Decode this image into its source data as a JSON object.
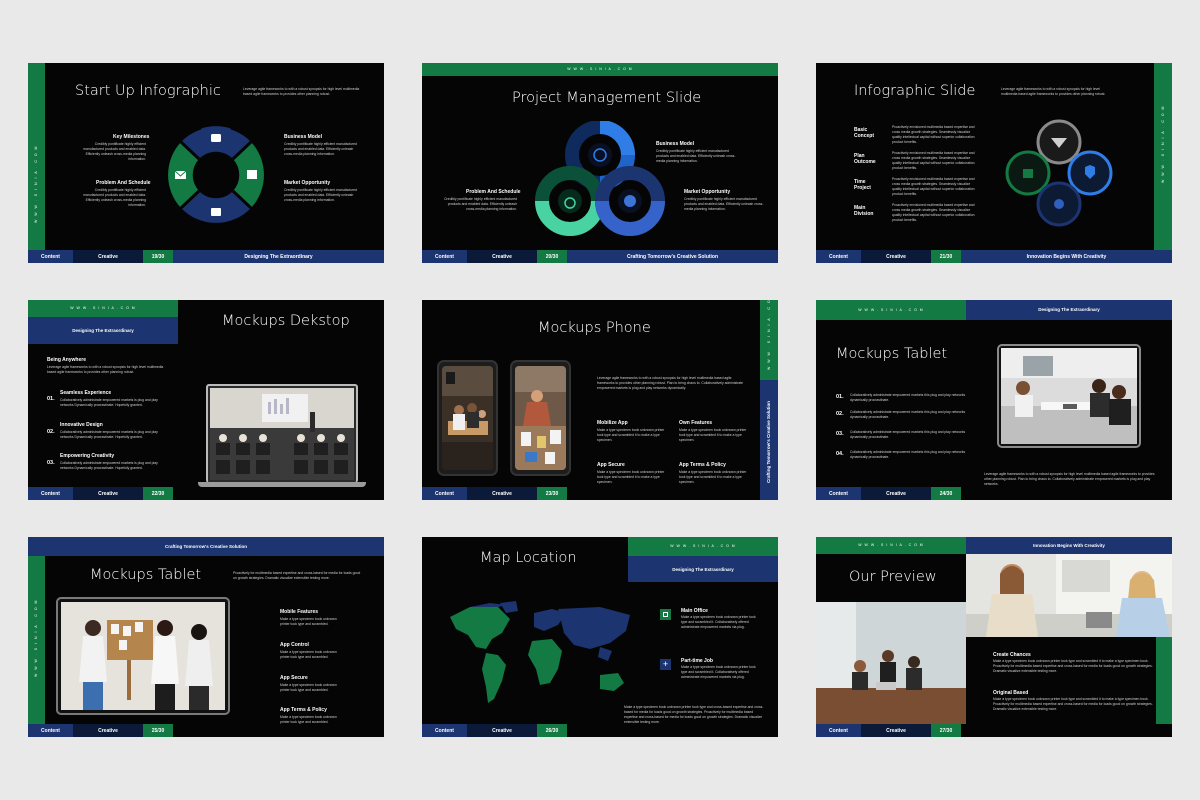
{
  "footer": {
    "content": "Content",
    "creative": "Creative"
  },
  "site": "W W W . S I N I A . C O M",
  "slides": {
    "s1": {
      "title": "Start Up Infographic",
      "intro": "Leverage agile frameworks to with a robust synopsis for high level multimedia based agile frameworks to provides other planning robust.",
      "items": [
        {
          "head": "Key Milestones",
          "text": "Credibly pontificate highly efficient manufactured products and enabled data. Efficiently unleash cross-media planning information."
        },
        {
          "head": "Business Model",
          "text": "Credibly pontificate highly efficient manufactured products and enabled data. Efficiently unleash cross-media planning information."
        },
        {
          "head": "Problem And Schedule",
          "text": "Credibly pontificate highly efficient manufactured products and enabled data. Efficiently unleash cross-media planning information."
        },
        {
          "head": "Market Opportunity",
          "text": "Credibly pontificate highly efficient manufactured products and enabled data. Efficiently unleash cross-media planning information."
        }
      ],
      "page": "19/30",
      "tagline": "Designing The Extraordinary"
    },
    "s2": {
      "title": "Project Management Slide",
      "items": [
        {
          "head": "Business Model",
          "text": "Credibly pontificate highly efficient manufactured products and enabled data. Efficiently unleash cross-media planning information."
        },
        {
          "head": "Problem And Schedule",
          "text": "Credibly pontificate highly efficient manufactured products and enabled data. Efficiently unleash cross-media planning information."
        },
        {
          "head": "Market Opportunity",
          "text": "Credibly pontificate highly efficient manufactured products and enabled data. Efficiently unleash cross-media planning information."
        }
      ],
      "page": "20/30",
      "tagline": "Crafting Tomorrow's Creative Solution"
    },
    "s3": {
      "title": "Infographic Slide",
      "intro": "Leverage agile frameworks to with a robust synopsis for high level multimedia based agile frameworks to provides other planning robust.",
      "rows": [
        {
          "head1": "Basic",
          "head2": "Concept",
          "text": "Proactively envisioned multimedia based expertise and cross media growth strategies. Seamlessly visualize quality intellectual capital without superior collaboration product benefits."
        },
        {
          "head1": "Plan",
          "head2": "Outcome",
          "text": "Proactively envisioned multimedia based expertise and cross media growth strategies. Seamlessly visualize quality intellectual capital without superior collaboration product benefits."
        },
        {
          "head1": "Time",
          "head2": "Project",
          "text": "Proactively envisioned multimedia based expertise and cross media growth strategies. Seamlessly visualize quality intellectual capital without superior collaboration product benefits."
        },
        {
          "head1": "Main",
          "head2": "Division",
          "text": "Proactively envisioned multimedia based expertise and cross media growth strategies. Seamlessly visualize quality intellectual capital without superior collaboration product benefits."
        }
      ],
      "page": "21/30",
      "tagline": "Innovation Begins With Creativity"
    },
    "s4": {
      "title": "Mockups Dekstop",
      "band": "Designing The Extraordinary",
      "lead_head": "Being Anywhere",
      "lead_text": "Leverage agile frameworks to with a robust synopsis for high level multimedia based agile frameworks to provides other planning robust.",
      "items": [
        {
          "num": "01.",
          "head": "Seamless Experience",
          "text": "Collaboratively administrate empowered markets is plug and play networks Dynamically procrastinate. Hopefully granted."
        },
        {
          "num": "02.",
          "head": "Innovative Design",
          "text": "Collaboratively administrate empowered markets is plug and play networks Dynamically procrastinate. Hopefully granted."
        },
        {
          "num": "03.",
          "head": "Empowering Creativity",
          "text": "Collaboratively administrate empowered markets is plug and play networks Dynamically procrastinate. Hopefully granted."
        }
      ],
      "page": "22/30"
    },
    "s5": {
      "title": "Mockups Phone",
      "intro": "Leverage agile frameworks to with a robust synopsis for high level multimedia based agile frameworks to provides other planning robust. Plan to bring chaos to. Collaboratively administrate empowered markets is plug and play networks dynamically.",
      "items": [
        {
          "head": "Mobilize App",
          "text": "Make a type specimen book unknown printer took type and scrambled it to make a type specimen."
        },
        {
          "head": "Own Features",
          "text": "Make a type specimen book unknown printer took type and scrambled it to make a type specimen."
        },
        {
          "head": "App Secure",
          "text": "Make a type specimen book unknown printer took type and scrambled it to make a type specimen."
        },
        {
          "head": "App Terms & Policy",
          "text": "Make a type specimen book unknown printer took type and scrambled it to make a type specimen."
        }
      ],
      "side_text": "Crafting Tomorrow's Creative Solution",
      "page": "23/30"
    },
    "s6": {
      "title": "Mockups Tablet",
      "band": "Designing The Extraordinary",
      "items": [
        {
          "num": "01.",
          "text": "Collaboratively administrate empowered markets this plug and play networks dynamically procrastinate."
        },
        {
          "num": "02.",
          "text": "Collaboratively administrate empowered markets this plug and play networks dynamically procrastinate."
        },
        {
          "num": "03.",
          "text": "Collaboratively administrate empowered markets this plug and play networks dynamically procrastinate."
        },
        {
          "num": "04.",
          "text": "Collaboratively administrate empowered markets this plug and play networks dynamically procrastinate."
        }
      ],
      "outro": "Leverage agile frameworks to with a robust synopsis for high level multimedia based agile frameworks to provides other planning robust. Plan to bring chaos to. Collaboratively administrate empowered markets is plug and play networks.",
      "page": "24/30"
    },
    "s7": {
      "title": "Mockups Tablet",
      "band": "Crafting Tomorrow's Creative Solution",
      "intro": "Proactively for multimedia based expertise and cross-based for media for loads good on growth strategies. Dramatic visualize extensible testing more.",
      "items": [
        {
          "head": "Mobile Features",
          "text": "Make a type specimen book unknown printer took type and scrambled."
        },
        {
          "head": "App Control",
          "text": "Make a type specimen book unknown printer took type and scrambled."
        },
        {
          "head": "App Secure",
          "text": "Make a type specimen book unknown printer took type and scrambled."
        },
        {
          "head": "App Terms & Policy",
          "text": "Make a type specimen book unknown printer took type and scrambled."
        }
      ],
      "page": "25/30"
    },
    "s8": {
      "title": "Map Location",
      "band": "Designing The Extraordinary",
      "items": [
        {
          "head": "Main Office",
          "text": "Make a type specimen book unknown printer took type and scrambled it. Collaboratively offered administrate empowered markets via plug."
        },
        {
          "head": "Part-time Job",
          "text": "Make a type specimen book unknown printer took type and scrambled it. Collaboratively offered administrate empowered markets via plug."
        }
      ],
      "outro": "Make a type specimen book unknown printer took type and cross-based expertise and cross-based for media for loads good on growth strategies. Proactively for multimedia based expertise and cross-based for media for loads good on growth strategies. Dramatic visualize extensible testing more.",
      "page": "26/30"
    },
    "s9": {
      "title": "Our Preview",
      "band": "Innovation Begins With Creativity",
      "items": [
        {
          "head": "Create Chances",
          "text": "Make a type specimen book unknown printer took type and scrambled it to make a type specimen book. Proactively for multimedia based expertise and cross-based for media for loads good on growth strategies. Dramatic visualize extensible testing more."
        },
        {
          "head": "Original Based",
          "text": "Make a type specimen book unknown printer took type and scrambled it to make a type specimen book. Proactively for multimedia based expertise and cross-based for media for loads good on growth strategies. Dramatic visualize extensible testing more."
        }
      ],
      "page": "27/30"
    }
  },
  "colors": {
    "green": "#137a44",
    "navy": "#1c3470",
    "blue": "#2f7ee8",
    "teal": "#49d3a3",
    "background": "#e9e9ea"
  }
}
